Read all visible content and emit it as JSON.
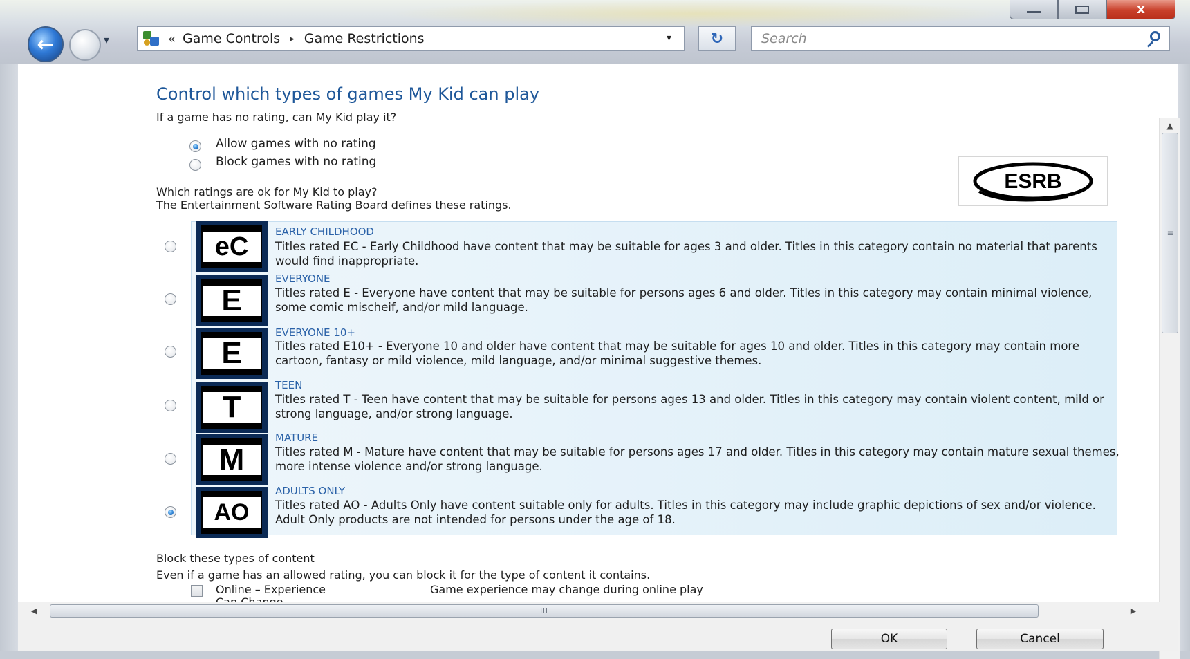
{
  "window": {
    "caption_minimize": "",
    "caption_maximize": "",
    "caption_close": "x"
  },
  "nav": {
    "back_glyph": "←",
    "recent_glyph": "▾",
    "address_chevron": "«",
    "breadcrumbs": [
      "Game Controls",
      "Game Restrictions"
    ],
    "breadcrumb_separator": "▸",
    "address_dropdown": "▾",
    "refresh_glyph": "↻",
    "search_placeholder": "Search"
  },
  "page": {
    "title": "Control which types of games My Kid can play",
    "no_rating_question": "If a game has no rating, can My Kid play it?",
    "no_rating_options": [
      {
        "label": "Allow games with no rating",
        "checked": true
      },
      {
        "label": "Block games with no rating",
        "checked": false
      }
    ],
    "ratings_question": "Which ratings are ok for My Kid to play?",
    "ratings_note": "The Entertainment Software Rating Board defines these ratings.",
    "esrb_logo_text": "ESRB",
    "ratings": [
      {
        "badge": "eC",
        "title": "EARLY CHILDHOOD",
        "selected": false,
        "desc": "Titles rated EC - Early Childhood have content that may be suitable for ages 3 and older. Titles in this category contain no material that parents would find inappropriate."
      },
      {
        "badge": "E",
        "title": "EVERYONE",
        "selected": false,
        "desc": "Titles rated E - Everyone have content that may be suitable for persons ages 6 and older. Titles in this category may contain minimal violence, some comic mischeif, and/or mild language."
      },
      {
        "badge": "E",
        "title": "EVERYONE 10+",
        "selected": false,
        "desc": "Titles rated E10+ - Everyone 10 and older have content that may be suitable for ages 10 and older. Titles in this category may contain more cartoon, fantasy or mild violence, mild language, and/or minimal suggestive themes."
      },
      {
        "badge": "T",
        "title": "TEEN",
        "selected": false,
        "desc": "Titles rated T - Teen have content that may be suitable for persons ages 13 and older. Titles in this category may contain violent content, mild or strong language, and/or strong language."
      },
      {
        "badge": "M",
        "title": "MATURE",
        "selected": false,
        "desc": "Titles rated M - Mature have content that may be suitable for persons ages 17 and older. Titles in this category may contain mature sexual themes, more intense violence and/or strong language."
      },
      {
        "badge": "AO",
        "title": "ADULTS ONLY",
        "selected": true,
        "desc": "Titles rated AO - Adults Only have content suitable only for adults.  Titles in this category may include graphic depictions of sex and/or violence.  Adult Only products are not intended for persons under the age of 18."
      }
    ],
    "block_title": "Block these types of content",
    "block_note": "Even if a game has an allowed rating, you can block it for the type of content it contains.",
    "content_types": [
      {
        "label_line1": "Online – Experience",
        "label_line2": "Can Change",
        "desc": "Game experience may change during online play",
        "checked": false
      }
    ]
  },
  "scrollbars": {
    "v_up": "▲",
    "v_down": "▼",
    "v_grip": "≡",
    "h_left": "◀",
    "h_right": "▶",
    "h_grip": "III"
  },
  "footer": {
    "ok_label": "OK",
    "cancel_label": "Cancel"
  }
}
